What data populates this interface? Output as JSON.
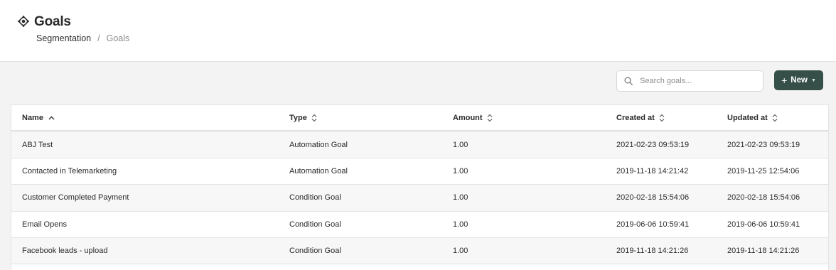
{
  "page": {
    "title": "Goals",
    "breadcrumb": {
      "parent": "Segmentation",
      "separator": "/",
      "current": "Goals"
    }
  },
  "toolbar": {
    "search_placeholder": "Search goals...",
    "search_value": "",
    "new_button_label": "New",
    "accent_color": "#365049"
  },
  "table": {
    "columns": [
      {
        "label": "Name",
        "sort": "ascending"
      },
      {
        "label": "Type",
        "sort": "none"
      },
      {
        "label": "Amount",
        "sort": "none"
      },
      {
        "label": "Created at",
        "sort": "none"
      },
      {
        "label": "Updated at",
        "sort": "none"
      }
    ],
    "rows": [
      {
        "name": "ABJ Test",
        "type": "Automation Goal",
        "amount": "1.00",
        "created": "2021-02-23 09:53:19",
        "updated": "2021-02-23 09:53:19"
      },
      {
        "name": "Contacted in Telemarketing",
        "type": "Automation Goal",
        "amount": "1.00",
        "created": "2019-11-18 14:21:42",
        "updated": "2019-11-25 12:54:06"
      },
      {
        "name": "Customer Completed Payment",
        "type": "Condition Goal",
        "amount": "1.00",
        "created": "2020-02-18 15:54:06",
        "updated": "2020-02-18 15:54:06"
      },
      {
        "name": "Email Opens",
        "type": "Condition Goal",
        "amount": "1.00",
        "created": "2019-06-06 10:59:41",
        "updated": "2019-06-06 10:59:41"
      },
      {
        "name": "Facebook leads - upload",
        "type": "Condition Goal",
        "amount": "1.00",
        "created": "2019-11-18 14:21:26",
        "updated": "2019-11-18 14:21:26"
      }
    ]
  }
}
